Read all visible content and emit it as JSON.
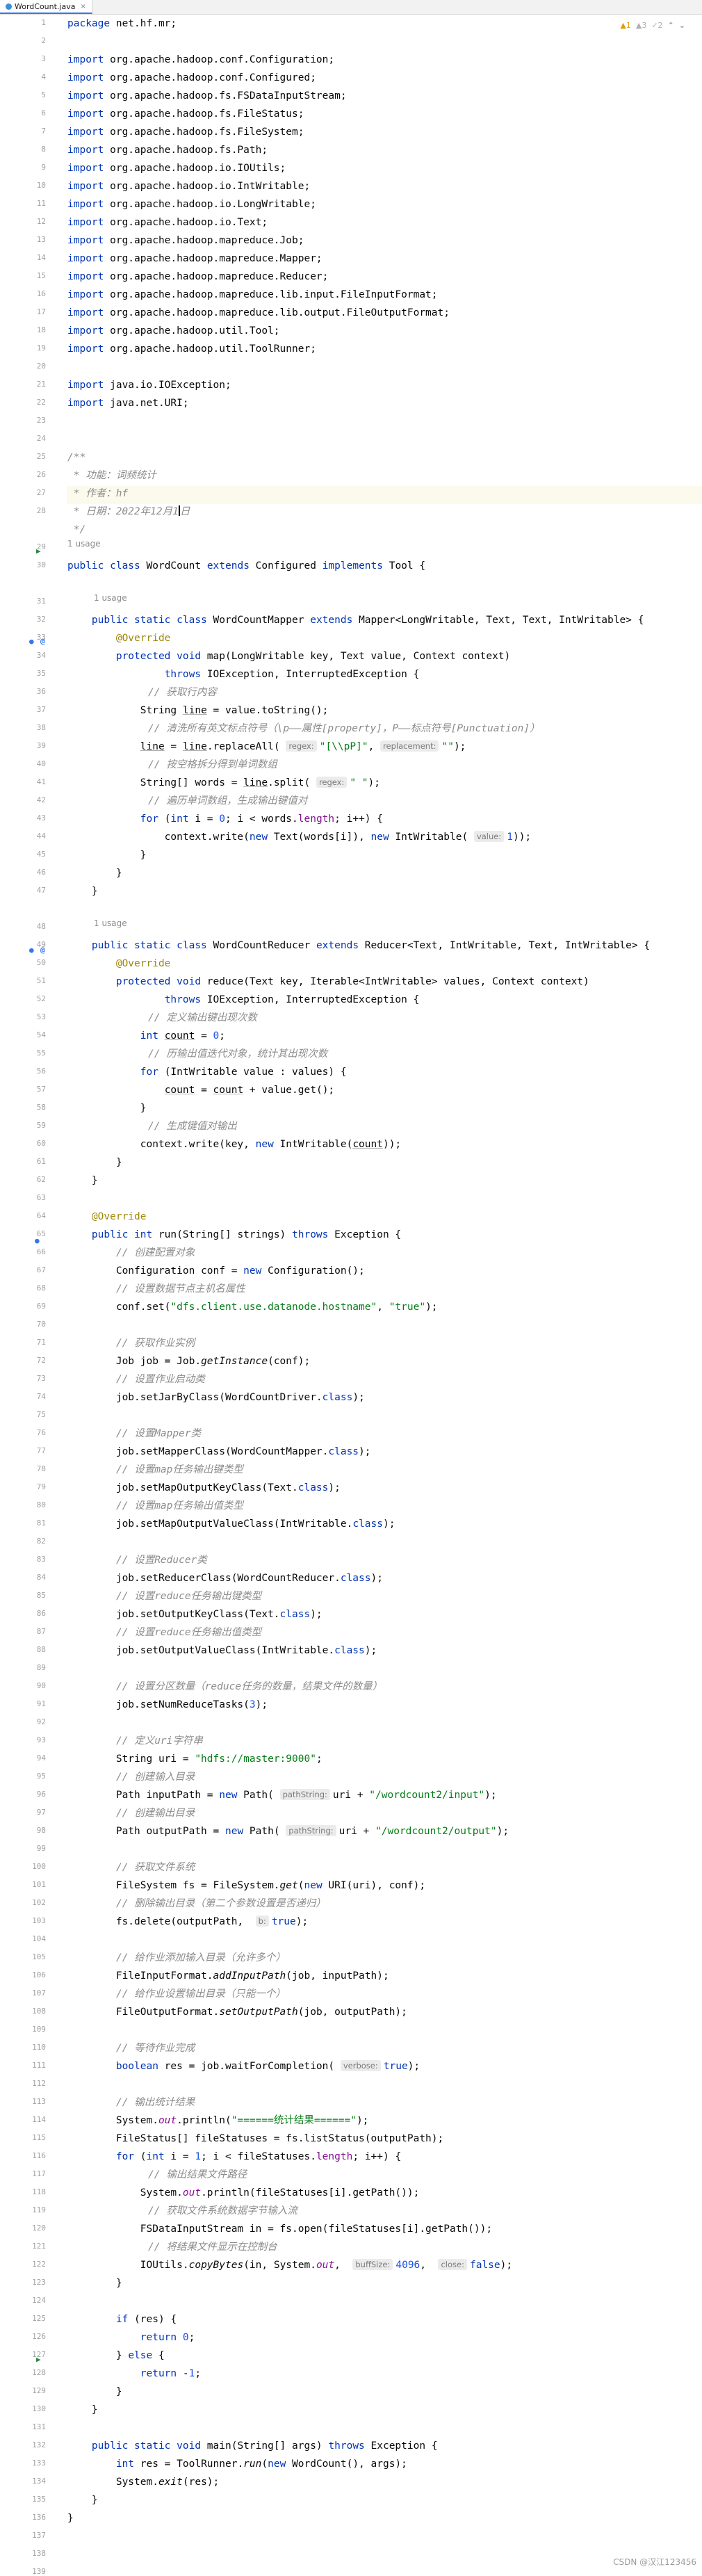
{
  "tab": {
    "filename": "WordCount.java",
    "close_glyph": "×"
  },
  "indicators": {
    "warnings": "▲1",
    "weak_warnings": "▲3",
    "typos": "✓2"
  },
  "watermark": "CSDN @汉江123456",
  "usages": [
    "1 usage",
    "1 usage",
    "1 usage"
  ],
  "hints": {
    "regex": "regex:",
    "replacement": "replacement:",
    "value": "value:",
    "pathString": "pathString:",
    "b": "b:",
    "verbose": "verbose:",
    "buffSize": "buffSize:",
    "close": "close:"
  },
  "lines": {
    "l1_pkg": "net.hf.mr;",
    "imports": [
      "org.apache.hadoop.conf.Configuration;",
      "org.apache.hadoop.conf.Configured;",
      "org.apache.hadoop.fs.FSDataInputStream;",
      "org.apache.hadoop.fs.FileStatus;",
      "org.apache.hadoop.fs.FileSystem;",
      "org.apache.hadoop.fs.Path;",
      "org.apache.hadoop.io.IOUtils;",
      "org.apache.hadoop.io.IntWritable;",
      "org.apache.hadoop.io.LongWritable;",
      "org.apache.hadoop.io.Text;",
      "org.apache.hadoop.mapreduce.Job;",
      "org.apache.hadoop.mapreduce.Mapper;",
      "org.apache.hadoop.mapreduce.Reducer;",
      "org.apache.hadoop.mapreduce.lib.input.FileInputFormat;",
      "org.apache.hadoop.mapreduce.lib.output.FileOutputFormat;",
      "org.apache.hadoop.util.Tool;",
      "org.apache.hadoop.util.ToolRunner;"
    ],
    "imports2": [
      "java.io.IOException;",
      "java.net.URI;"
    ],
    "doc_func": " * 功能：词频统计",
    "doc_author": " * 作者：hf",
    "doc_date_a": " * 日期：2022年12月1",
    "doc_date_b": "日",
    "comments": {
      "c35": "// 获取行内容",
      "c37": "// 清洗所有英文标点符号（\\p——属性[property]，P——标点符号[Punctuation]）",
      "c39": "// 按空格拆分得到单词数组",
      "c41": "// 遍历单词数组，生成输出键值对",
      "c53": "// 定义输出键出现次数",
      "c55": "// 历输出值迭代对象，统计其出现次数",
      "c58": "// 生成键值对输出",
      "c65": "// 创建配置对象",
      "c67": "// 设置数据节点主机名属性",
      "c70": "// 获取作业实例",
      "c72": "// 设置作业启动类",
      "c75": "// 设置Mapper类",
      "c77": "// 设置map任务输出键类型",
      "c79": "// 设置map任务输出值类型",
      "c82": "// 设置Reducer类",
      "c84": "// 设置reduce任务输出键类型",
      "c86": "// 设置reduce任务输出值类型",
      "c89": "// 设置分区数量（reduce任务的数量，结果文件的数量）",
      "c92": "// 定义uri字符串",
      "c94": "// 创建输入目录",
      "c96": "// 创建输出目录",
      "c99": "// 获取文件系统",
      "c101": "// 删除输出目录（第二个参数设置是否递归）",
      "c104": "// 给作业添加输入目录（允许多个）",
      "c106": "// 给作业设置输出目录（只能一个）",
      "c109": "// 等待作业完成",
      "c112": "// 输出统计结果",
      "c116": "// 输出结果文件路径",
      "c118": "// 获取文件系统数据字节输入流",
      "c120": "// 将结果文件显示在控制台"
    }
  }
}
